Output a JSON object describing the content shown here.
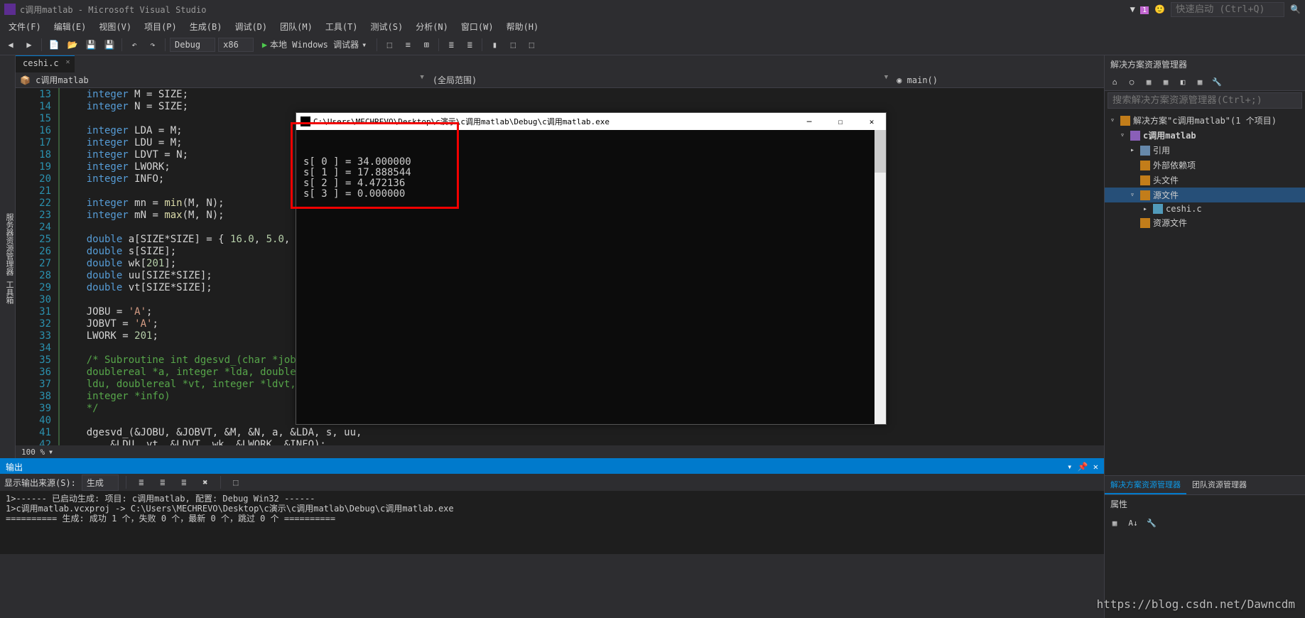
{
  "window": {
    "title": "c调用matlab - Microsoft Visual Studio",
    "flag": "1",
    "quick_launch_ph": "快速启动 (Ctrl+Q)"
  },
  "menu": [
    "文件(F)",
    "编辑(E)",
    "视图(V)",
    "项目(P)",
    "生成(B)",
    "调试(D)",
    "团队(M)",
    "工具(T)",
    "测试(S)",
    "分析(N)",
    "窗口(W)",
    "帮助(H)"
  ],
  "toolbar": {
    "config": "Debug",
    "platform": "x86",
    "start": "本地 Windows 调试器"
  },
  "left_strips": [
    "服务器资源管理器",
    "工具箱"
  ],
  "tab": {
    "file": "ceshi.c"
  },
  "nav": {
    "left": "c调用matlab",
    "mid": "(全局范围)",
    "right": "main()"
  },
  "code_lines": [
    {
      "n": 13,
      "h": "    <span class='k-type'>integer</span> M = SIZE;"
    },
    {
      "n": 14,
      "h": "    <span class='k-type'>integer</span> N = SIZE;"
    },
    {
      "n": 15,
      "h": ""
    },
    {
      "n": 16,
      "h": "    <span class='k-type'>integer</span> LDA = M;"
    },
    {
      "n": 17,
      "h": "    <span class='k-type'>integer</span> LDU = M;"
    },
    {
      "n": 18,
      "h": "    <span class='k-type'>integer</span> LDVT = N;"
    },
    {
      "n": 19,
      "h": "    <span class='k-type'>integer</span> LWORK;"
    },
    {
      "n": 20,
      "h": "    <span class='k-type'>integer</span> INFO;"
    },
    {
      "n": 21,
      "h": ""
    },
    {
      "n": 22,
      "h": "    <span class='k-type'>integer</span> mn = <span class='k-id'>min</span>(M, N);"
    },
    {
      "n": 23,
      "h": "    <span class='k-type'>integer</span> mN = <span class='k-id'>max</span>(M, N);"
    },
    {
      "n": 24,
      "h": ""
    },
    {
      "n": 25,
      "h": "    <span class='k-type'>double</span> a[SIZE*SIZE] = { <span class='k-num'>16.0</span>, <span class='k-num'>5.0</span>,"
    },
    {
      "n": 26,
      "h": "    <span class='k-type'>double</span> s[SIZE];"
    },
    {
      "n": 27,
      "h": "    <span class='k-type'>double</span> wk[<span class='k-num'>201</span>];"
    },
    {
      "n": 28,
      "h": "    <span class='k-type'>double</span> uu[SIZE*SIZE];"
    },
    {
      "n": 29,
      "h": "    <span class='k-type'>double</span> vt[SIZE*SIZE];"
    },
    {
      "n": 30,
      "h": ""
    },
    {
      "n": 31,
      "h": "    JOBU = <span class='k-str'>'A'</span>;"
    },
    {
      "n": 32,
      "h": "    JOBVT = <span class='k-str'>'A'</span>;"
    },
    {
      "n": 33,
      "h": "    LWORK = <span class='k-num'>201</span>;"
    },
    {
      "n": 34,
      "h": ""
    },
    {
      "n": 35,
      "h": "    <span class='k-cmt'>/* Subroutine int dgesvd_(char *job</span>"
    },
    {
      "n": 36,
      "h": "    <span class='k-cmt'>doublereal *a, integer *lda, double</span>"
    },
    {
      "n": 37,
      "h": "    <span class='k-cmt'>ldu, doublereal *vt, integer *ldvt,</span>"
    },
    {
      "n": 38,
      "h": "    <span class='k-cmt'>integer *info)</span>"
    },
    {
      "n": 39,
      "h": "    <span class='k-cmt'>*/</span>"
    },
    {
      "n": 40,
      "h": ""
    },
    {
      "n": 41,
      "h": "    dgesvd_(&amp;JOBU, &amp;JOBVT, &amp;M, &amp;N, a, &amp;LDA, s, uu,"
    },
    {
      "n": 42,
      "h": "        &amp;LDU  vt  &amp;LDVT  wk  &amp;LWORK  &amp;INFO);"
    }
  ],
  "zoom": "100 %",
  "output": {
    "title": "输出",
    "src_label": "显示输出来源(S):",
    "src_value": "生成",
    "body": "1>------ 已启动生成: 项目: c调用matlab, 配置: Debug Win32 ------\n1>c调用matlab.vcxproj -> C:\\Users\\MECHREVO\\Desktop\\c演示\\c调用matlab\\Debug\\c调用matlab.exe\n========== 生成: 成功 1 个，失败 0 个，最新 0 个，跳过 0 个 =========="
  },
  "solution": {
    "header": "解决方案资源管理器",
    "search_ph": "搜索解决方案资源管理器(Ctrl+;)",
    "root": "解决方案\"c调用matlab\"(1 个项目)",
    "project": "c调用matlab",
    "nodes": [
      "引用",
      "外部依赖项",
      "头文件",
      "源文件",
      "ceshi.c",
      "资源文件"
    ],
    "tabs": [
      "解决方案资源管理器",
      "团队资源管理器"
    ],
    "props": "属性"
  },
  "console": {
    "title": "C:\\Users\\MECHREVO\\Desktop\\c演示\\c调用matlab\\Debug\\c调用matlab.exe",
    "lines": [
      "s[ 0 ] = 34.000000",
      "s[ 1 ] = 17.888544",
      "s[ 2 ] = 4.472136",
      "s[ 3 ] = 0.000000"
    ]
  },
  "watermark": "https://blog.csdn.net/Dawncdm"
}
